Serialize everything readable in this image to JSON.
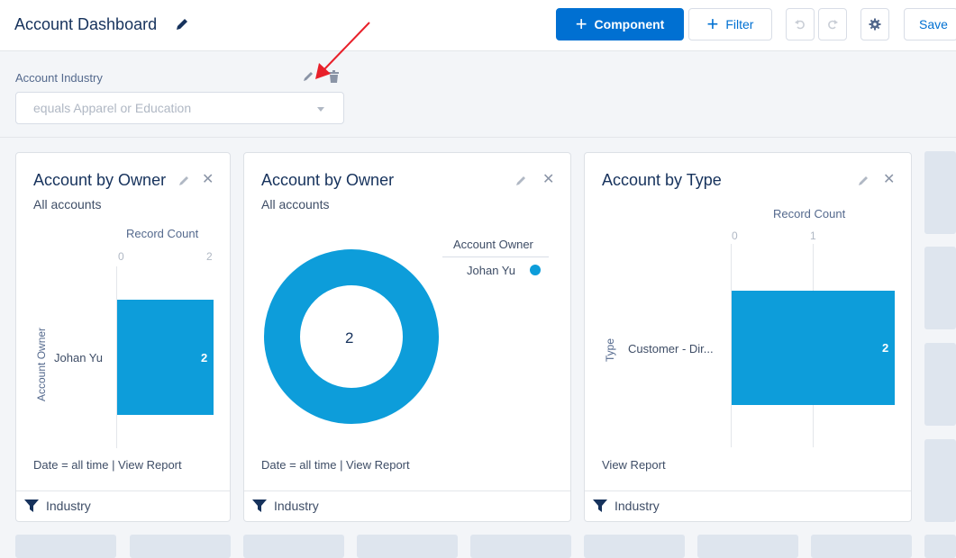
{
  "header": {
    "title": "Account Dashboard",
    "component_label": "Component",
    "filter_label": "Filter",
    "save_label": "Save"
  },
  "dashboard_filter": {
    "label": "Account Industry",
    "value": "equals Apparel or Education"
  },
  "widgets": [
    {
      "title": "Account by Owner",
      "subtitle": "All accounts",
      "footer": "Date = all time | View Report",
      "filter_label": "Industry",
      "chart": {
        "axis_title": "Record Count",
        "y_axis_title": "Account Owner",
        "tick_min": "0",
        "tick_max": "2",
        "category": "Johan Yu",
        "value_label": "2"
      }
    },
    {
      "title": "Account by Owner",
      "subtitle": "All accounts",
      "footer": "Date = all time | View Report",
      "filter_label": "Industry",
      "chart": {
        "center_total": "2",
        "legend_title": "Account Owner",
        "legend_item": "Johan Yu"
      }
    },
    {
      "title": "Account by Type",
      "footer": "View Report",
      "filter_label": "Industry",
      "chart": {
        "axis_title": "Record Count",
        "y_axis_title": "Type",
        "tick_min": "0",
        "tick_max": "1",
        "category": "Customer - Dir...",
        "value_label": "2"
      }
    }
  ],
  "chart_data": [
    {
      "type": "bar",
      "title": "Account by Owner",
      "subtitle": "All accounts",
      "xlabel": "Record Count",
      "ylabel": "Account Owner",
      "categories": [
        "Johan Yu"
      ],
      "values": [
        2
      ],
      "xlim": [
        0,
        2
      ]
    },
    {
      "type": "pie",
      "title": "Account by Owner",
      "subtitle": "All accounts",
      "categories": [
        "Johan Yu"
      ],
      "values": [
        2
      ],
      "center_total": 2,
      "legend_title": "Account Owner"
    },
    {
      "type": "bar",
      "title": "Account by Type",
      "xlabel": "Record Count",
      "ylabel": "Type",
      "categories": [
        "Customer - Dir..."
      ],
      "values": [
        2
      ],
      "xlim": [
        0,
        1
      ]
    }
  ],
  "colors": {
    "brand": "#0070d2",
    "chart": "#0d9dda",
    "annotation_arrow": "#e8202a"
  },
  "icons": {
    "edit": "pencil-icon",
    "delete": "trash-icon",
    "close": "close-icon",
    "undo": "undo-icon",
    "redo": "redo-icon",
    "settings": "gear-icon",
    "filter": "funnel-icon"
  }
}
